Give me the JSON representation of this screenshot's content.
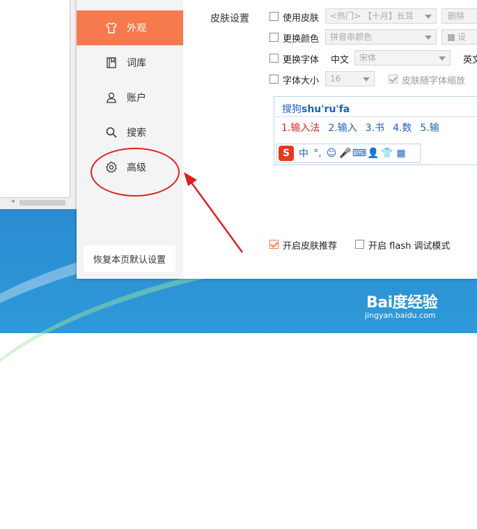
{
  "sidebar": {
    "items": [
      {
        "label": "外观",
        "icon": "shirt-icon",
        "active": true
      },
      {
        "label": "词库",
        "icon": "dictionary-icon",
        "active": false
      },
      {
        "label": "账户",
        "icon": "user-icon",
        "active": false
      },
      {
        "label": "搜索",
        "icon": "search-icon",
        "active": false
      },
      {
        "label": "高级",
        "icon": "gear-icon",
        "active": false
      }
    ],
    "restore_label": "恢复本页默认设置"
  },
  "skin": {
    "section_title": "皮肤设置",
    "use_skin_label": "使用皮肤",
    "skin_select_value": "<热门> 【十月】长耳",
    "delete_label": "删除",
    "change_color_label": "更换颜色",
    "color_select_value": "拼音串颜色",
    "color_swatch_label": "设",
    "change_font_label": "更换字体",
    "chinese_label": "中文",
    "chinese_font_value": "宋体",
    "english_label": "英文",
    "font_size_label": "字体大小",
    "font_size_value": "16",
    "scale_with_skin_label": "皮肤随字体缩放",
    "recommend_label": "开启皮肤推荐",
    "flash_debug_label": "开启 flash 调试模式"
  },
  "preview": {
    "pinyin_prefix": "搜狗",
    "pinyin": "shu'ru'fa",
    "candidates": [
      "1.输入法",
      "2.输入",
      "3.书",
      "4.数",
      "5.输"
    ],
    "toolbar": [
      "S",
      "中",
      "°,",
      "☺",
      "🎤",
      "⌨",
      "👤",
      "👕",
      "▦"
    ]
  },
  "watermark": {
    "logo": "Bai度经验",
    "url": "jingyan.baidu.com"
  },
  "colors": {
    "accent": "#f77a4e",
    "annotation": "#e02020",
    "preview_blue": "#1f5fbf",
    "preview_red": "#e0271f"
  }
}
